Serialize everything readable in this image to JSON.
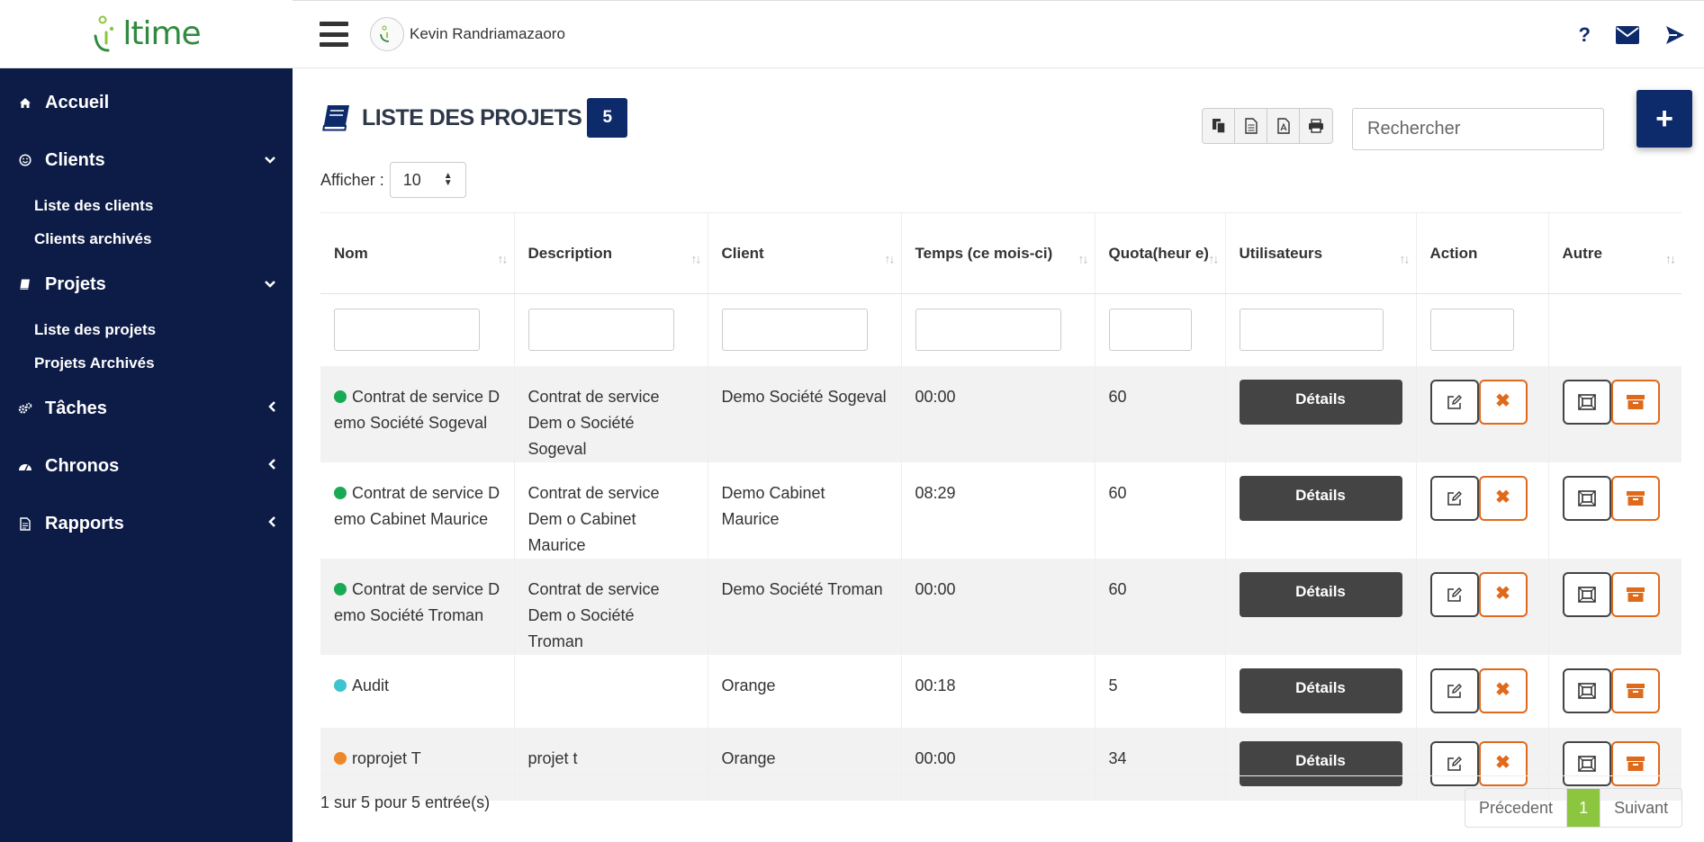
{
  "app": {
    "logo_text": "ltime"
  },
  "sidebar": {
    "items": [
      {
        "label": "Accueil",
        "icon": "home-icon"
      },
      {
        "label": "Clients",
        "icon": "smile-icon",
        "chevron": "⌄",
        "subitems": [
          "Liste des clients",
          "Clients archivés"
        ]
      },
      {
        "label": "Projets",
        "icon": "book-icon",
        "chevron": "⌄",
        "subitems": [
          "Liste des projets",
          "Projets Archivés"
        ]
      },
      {
        "label": "Tâches",
        "icon": "gears-icon",
        "chevron": "‹"
      },
      {
        "label": "Chronos",
        "icon": "dashboard-icon",
        "chevron": "‹"
      },
      {
        "label": "Rapports",
        "icon": "file-icon",
        "chevron": "‹"
      }
    ]
  },
  "header": {
    "user_name": "Kevin Randriamazaoro",
    "help_glyph": "?"
  },
  "page": {
    "title": "LISTE DES PROJETS",
    "count": "5",
    "search_placeholder": "Rechercher",
    "add_glyph": "+",
    "show_label": "Afficher :",
    "show_value": "10"
  },
  "table": {
    "headers": [
      "Nom",
      "Description",
      "Client",
      "Temps (ce mois-ci)",
      "Quota(heur e)",
      "Utilisateurs",
      "Action",
      "Autre"
    ],
    "details_label": "Détails",
    "delete_glyph": "✖",
    "rows": [
      {
        "name": "Contrat de service D emo Société Sogeval",
        "status_color": "#1aaa55",
        "description": "Contrat de service Dem o Société Sogeval",
        "client": "Demo Société Sogeval",
        "time": "00:00",
        "quota": "60"
      },
      {
        "name": "Contrat de service D emo Cabinet Maurice",
        "status_color": "#1aaa55",
        "description": "Contrat de service Dem o Cabinet Maurice",
        "client": "Demo Cabinet Maurice",
        "time": "08:29",
        "quota": "60"
      },
      {
        "name": "Contrat de service D emo Société Troman",
        "status_color": "#1aaa55",
        "description": "Contrat de service Dem o Société Troman",
        "client": "Demo Société Troman",
        "time": "00:00",
        "quota": "60"
      },
      {
        "name": "Audit",
        "status_color": "#3cc4d0",
        "description": "",
        "client": "Orange",
        "time": "00:18",
        "quota": "5"
      },
      {
        "name": "roprojet T",
        "status_color": "#f0862a",
        "description": "projet t",
        "client": "Orange",
        "time": "00:00",
        "quota": "34"
      }
    ]
  },
  "footer": {
    "info": "1 sur 5 pour 5 entrée(s)",
    "prev": "Précedent",
    "page": "1",
    "next": "Suivant"
  },
  "colors": {
    "sidebar_bg": "#0d1c47",
    "primary": "#0d2a6b",
    "accent_green": "#8cc63f",
    "danger_orange": "#e06a1b"
  }
}
